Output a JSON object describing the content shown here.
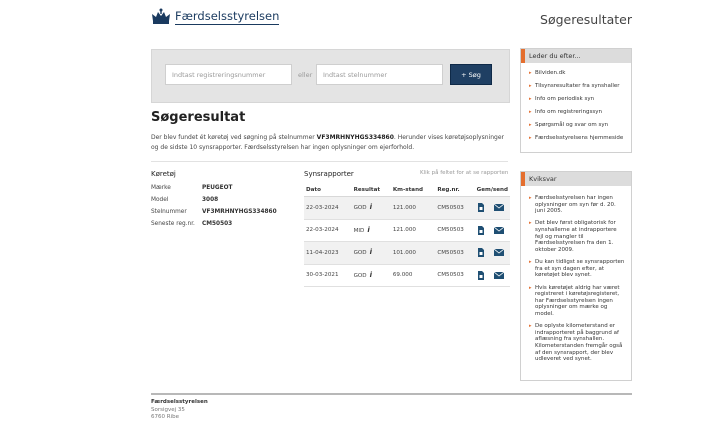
{
  "header": {
    "logo_text": "Færdselsstyrelsen",
    "page_heading": "Søgeresultater"
  },
  "search": {
    "reg_placeholder": "Indtast registreringsnummer",
    "or_label": "eller",
    "vin_placeholder": "Indtast stelnummer",
    "button_label": "+ Søg"
  },
  "main": {
    "title": "Søgeresultat",
    "intro_prefix": "Der blev fundet ét køretøj ved søgning på stelnummer",
    "intro_vin": "VF3MRHNYHGS334860",
    "intro_suffix": ". Herunder vises køretøjsoplysninger og de sidste 10 synsrapporter. Færdselsstyrelsen har ingen oplysninger om ejerforhold."
  },
  "vehicle": {
    "title": "Køretøj",
    "rows": [
      {
        "label": "Mærke",
        "value": "PEUGEOT"
      },
      {
        "label": "Model",
        "value": "3008"
      },
      {
        "label": "Stelnummer",
        "value": "VF3MRHNYHGS334860"
      },
      {
        "label": "Seneste reg.nr.",
        "value": "CM50503"
      }
    ]
  },
  "reports": {
    "title": "Synsrapporter",
    "hint": "Klik på feltet for at se rapporten",
    "columns": [
      "Dato",
      "Resultat",
      "Km-stand",
      "Reg.nr.",
      "Gem/send"
    ],
    "rows": [
      {
        "date": "22-03-2024",
        "result": "GOD",
        "km": "121.000",
        "reg": "CM50503"
      },
      {
        "date": "22-03-2024",
        "result": "MID",
        "km": "121.000",
        "reg": "CM50503"
      },
      {
        "date": "11-04-2023",
        "result": "GOD",
        "km": "101.000",
        "reg": "CM50503"
      },
      {
        "date": "30-03-2021",
        "result": "GOD",
        "km": "69.000",
        "reg": "CM50503"
      }
    ]
  },
  "sidebar": {
    "lookfor_title": "Leder du efter...",
    "lookfor_items": [
      "Bilviden.dk",
      "Tilsynsresultater fra synshaller",
      "Info om periodisk syn",
      "Info om registreringssyn",
      "Spørgsmål og svar om syn",
      "Færdselsstyrelsens hjemmeside"
    ],
    "quick_title": "Kviksvar",
    "quick_items": [
      [
        "Færdselsstyrelsen har ingen",
        "oplysninger om syn før d. 20.",
        "juni 2005."
      ],
      [
        "Det blev først obligatorisk for",
        "synshallerne at indrapportere",
        "fejl og mangler til",
        "Færdselsstyrelsen fra den 1.",
        "oktober 2009."
      ],
      [
        "Du kan tidligst se synsrapporten",
        "fra et syn dagen efter, at",
        "køretøjet blev synet."
      ],
      [
        "Hvis køretøjet aldrig har været",
        "registreret i køretøjsregisteret,",
        "har Færdselsstyrelsen ingen",
        "oplysninger om mærke og",
        "model."
      ],
      [
        "De oplyste kilometerstand er",
        "indrapporteret på baggrund af",
        "aflæsning fra synshallen.",
        "Kilometerstanden fremgår også",
        "af den synsrapport, der blev",
        "udleveret ved synet."
      ]
    ]
  },
  "footer": {
    "org": "Færdselsstyrelsen",
    "street": "Sorsigvej 35",
    "city": "6760 Ribe"
  },
  "colors": {
    "accent": "#e46e2e",
    "brand": "#1f3f63"
  }
}
